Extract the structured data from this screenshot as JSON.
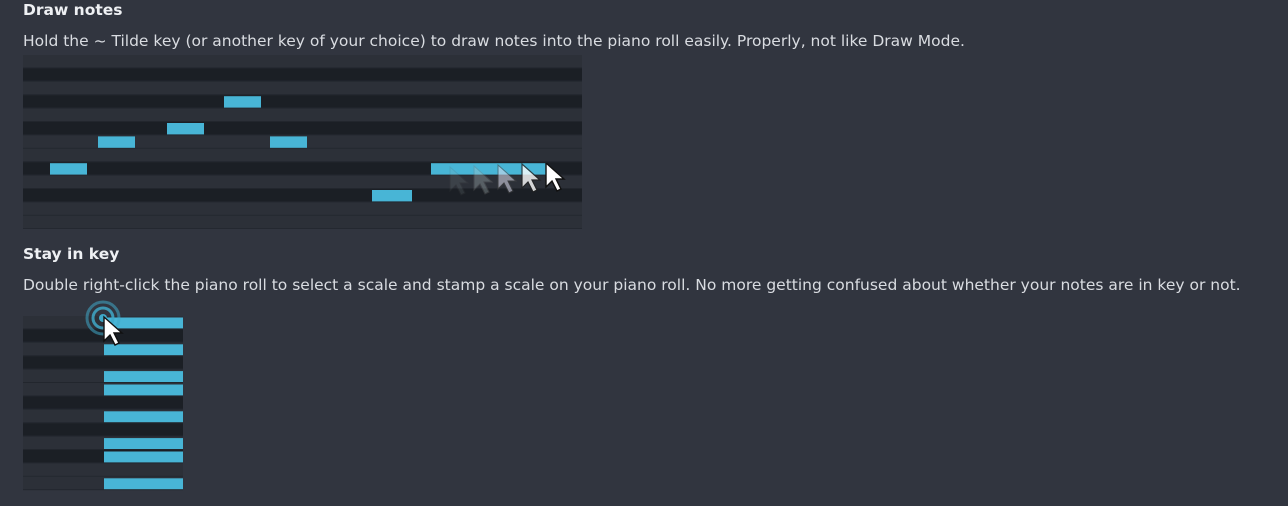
{
  "sections": {
    "draw_notes": {
      "title": "Draw notes",
      "description": "Hold the ~ Tilde key (or another key of your choice) to draw notes into the piano roll easily. Properly, not like Draw Mode."
    },
    "stay_in_key": {
      "title": "Stay in key",
      "description": "Double right-click the piano roll to select a scale and stamp a scale on your piano roll. No more getting confused about whether your notes are in key or not."
    }
  },
  "colors": {
    "background": "#31353f",
    "black_key_row": "#1b1f25",
    "white_key_row": "#2c3038",
    "row_separator": "#22262d",
    "note": "#48b5d6",
    "cursor": "#ffffff",
    "click_ring": "#3fa8c8"
  },
  "icons": {
    "cursor": "mouse-pointer-icon",
    "click": "double-click-ring-icon"
  }
}
